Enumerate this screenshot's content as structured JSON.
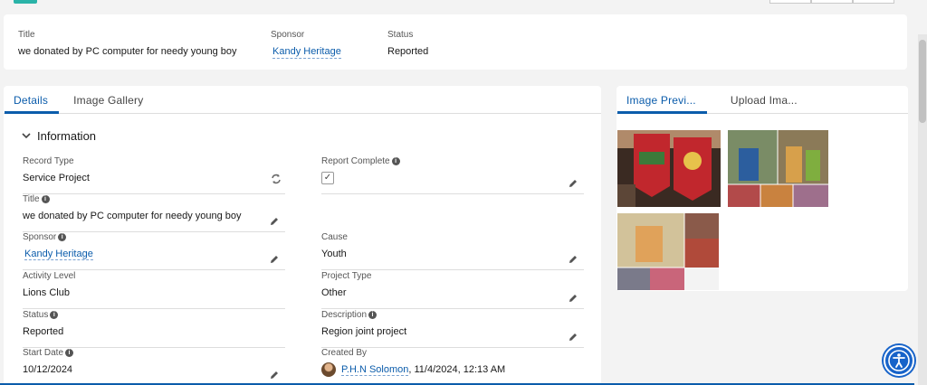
{
  "highlights": {
    "title_label": "Title",
    "title_value": "we donated by PC computer for needy young boy",
    "sponsor_label": "Sponsor",
    "sponsor_value": "Kandy Heritage",
    "status_label": "Status",
    "status_value": "Reported"
  },
  "details": {
    "tabs": [
      "Details",
      "Image Gallery"
    ],
    "section": "Information",
    "left_fields": [
      {
        "label": "Record Type",
        "value": "Service Project"
      },
      {
        "label": "Title",
        "value": "we donated by PC computer for needy young boy"
      },
      {
        "label": "Sponsor",
        "value": "Kandy Heritage"
      },
      {
        "label": "Activity Level",
        "value": "Lions Club"
      },
      {
        "label": "Status",
        "value": "Reported"
      },
      {
        "label": "Start Date",
        "value": "10/12/2024"
      }
    ],
    "right_fields": [
      {
        "label": "Report Complete",
        "value": "✓"
      },
      {
        "label": "Cause",
        "value": "Youth"
      },
      {
        "label": "Project Type",
        "value": "Other"
      },
      {
        "label": "Description",
        "value": "Region joint project"
      },
      {
        "label": "Created By",
        "value_name": "P.H.N Solomon",
        "value_rest": ", 11/4/2024, 12:13 AM"
      }
    ]
  },
  "gallery": {
    "tabs": [
      "Image Previ...",
      "Upload Ima..."
    ]
  },
  "colors": {
    "brand": "#0b5cab",
    "accessibility": "#1763c9"
  },
  "icons": [
    "pencil-icon",
    "refresh-icon",
    "info-icon",
    "chevron-down-icon",
    "accessibility-icon"
  ]
}
